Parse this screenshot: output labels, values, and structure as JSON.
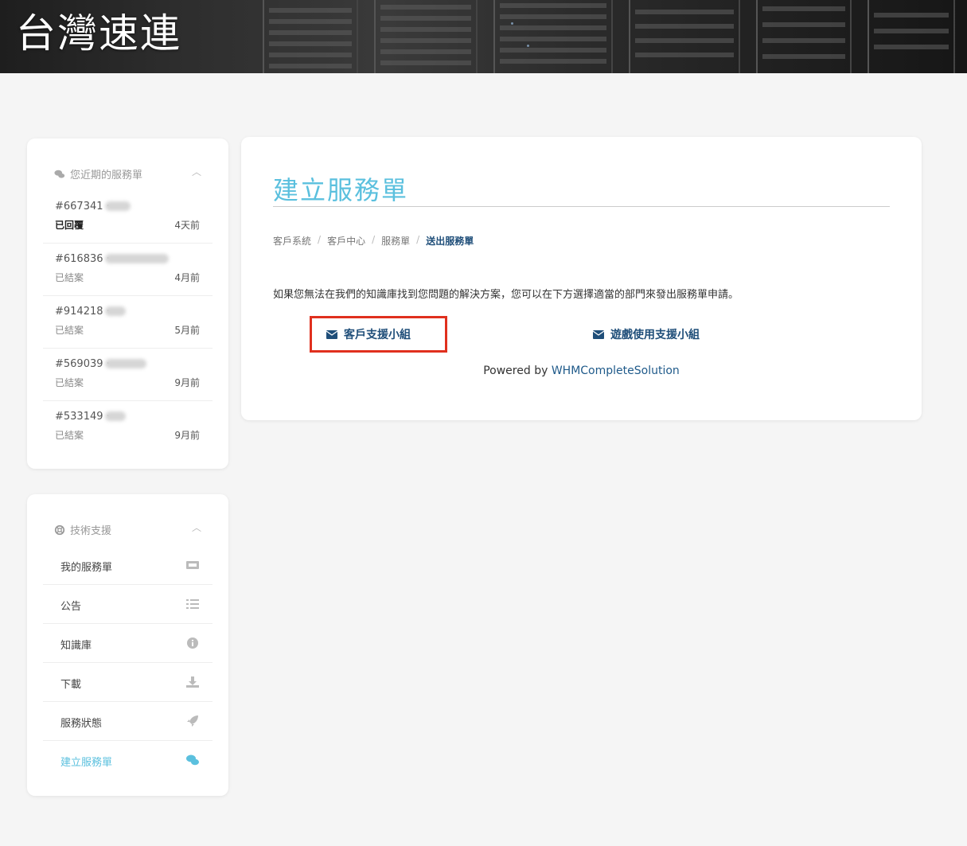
{
  "header": {
    "brand": "台灣速連"
  },
  "sidebar_tickets": {
    "title": "您近期的服務單",
    "items": [
      {
        "id": "#667341 ·",
        "status": "已回覆",
        "time": "4天前",
        "highlight": true
      },
      {
        "id": "#616836 ·",
        "status": "已結案",
        "time": "4月前",
        "highlight": false
      },
      {
        "id": "#914218 ·",
        "status": "已結案",
        "time": "5月前",
        "highlight": false
      },
      {
        "id": "#569039 ·",
        "status": "已結案",
        "time": "9月前",
        "highlight": false
      },
      {
        "id": "#533149 ·",
        "status": "已結案",
        "time": "9月前",
        "highlight": false
      }
    ]
  },
  "sidebar_support": {
    "title": "技術支援",
    "items": [
      {
        "label": "我的服務單",
        "icon": "ticket-icon"
      },
      {
        "label": "公告",
        "icon": "list-icon"
      },
      {
        "label": "知識庫",
        "icon": "info-icon"
      },
      {
        "label": "下載",
        "icon": "download-icon"
      },
      {
        "label": "服務狀態",
        "icon": "rocket-icon"
      },
      {
        "label": "建立服務單",
        "icon": "comments-icon",
        "active": true
      }
    ]
  },
  "main": {
    "title": "建立服務單",
    "breadcrumb": [
      "客戶系統",
      "客戶中心",
      "服務單",
      "送出服務單"
    ],
    "intro": "如果您無法在我們的知識庫找到您問題的解決方案，您可以在下方選擇適當的部門來發出服務單申請。",
    "departments": [
      {
        "label": "客戶支援小組",
        "icon": "envelope-icon"
      },
      {
        "label": "遊戲使用支援小組",
        "icon": "envelope-icon"
      }
    ],
    "powered_prefix": "Powered by",
    "powered_link": "WHMCompleteSolution"
  },
  "colors": {
    "accent": "#5bc0de",
    "link": "#1f4e79",
    "highlight_border": "#e0301e",
    "background": "#f5f5f5"
  }
}
